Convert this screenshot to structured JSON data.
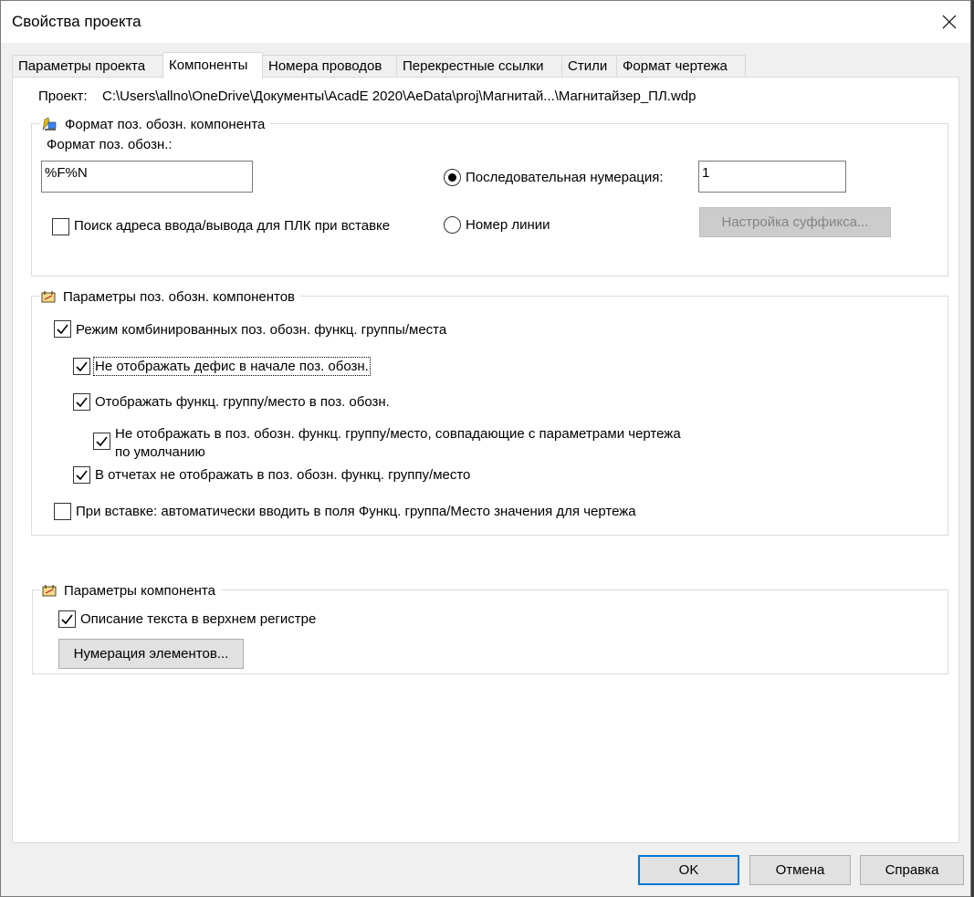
{
  "window": {
    "title": "Свойства проекта"
  },
  "tabs": [
    {
      "label": "Параметры проекта"
    },
    {
      "label": "Компоненты"
    },
    {
      "label": "Номера проводов"
    },
    {
      "label": "Перекрестные ссылки"
    },
    {
      "label": "Стили"
    },
    {
      "label": "Формат чертежа"
    }
  ],
  "project": {
    "label": "Проект:",
    "path": "C:\\Users\\allno\\OneDrive\\Документы\\AcadE 2020\\AeData\\proj\\Магнитай...\\Магнитайзер_ПЛ.wdp"
  },
  "tag_format": {
    "title": "Формат поз. обозн. компонента",
    "format_label": "Формат поз. обозн.:",
    "format_value": "%F%N",
    "plc_search_label": "Поиск адреса ввода/вывода для ПЛК при вставке",
    "plc_search_checked": false,
    "sequential_label": "Последовательная нумерация:",
    "sequential_selected": true,
    "sequential_value": "1",
    "line_number_label": "Номер линии",
    "line_number_selected": false,
    "suffix_button": "Настройка суффикса..."
  },
  "tag_options": {
    "title": "Параметры поз. обозн. компонентов",
    "combined_mode": {
      "label": "Режим комбинированных поз. обозн. функц. группы/места",
      "checked": true
    },
    "no_leading_hyphen": {
      "label": "Не отображать дефис в начале поз. обозн.",
      "checked": true
    },
    "show_installation": {
      "label": "Отображать функц. группу/место в поз. обозн.",
      "checked": true
    },
    "hide_matching_line1": "Не отображать в поз. обозн. функц. группу/место, совпадающие с параметрами чертежа",
    "hide_matching_line2": "по умолчанию",
    "hide_matching_checked": true,
    "reports_hide": {
      "label": "В отчетах не отображать в поз. обозн. функц. группу/место",
      "checked": true
    },
    "auto_fill": {
      "label": "При вставке: автоматически вводить в поля Функц. группа/Место значения для чертежа",
      "checked": false
    }
  },
  "component_options": {
    "title": "Параметры компонента",
    "uppercase": {
      "label": "Описание текста в верхнем регистре",
      "checked": true
    },
    "item_numbering_button": "Нумерация элементов..."
  },
  "footer": {
    "ok": "OK",
    "cancel": "Отмена",
    "help": "Справка"
  },
  "colors": {
    "accent": "#0078d7",
    "dialog_bg": "#f0f0f0",
    "panel_bg": "#ffffff"
  }
}
